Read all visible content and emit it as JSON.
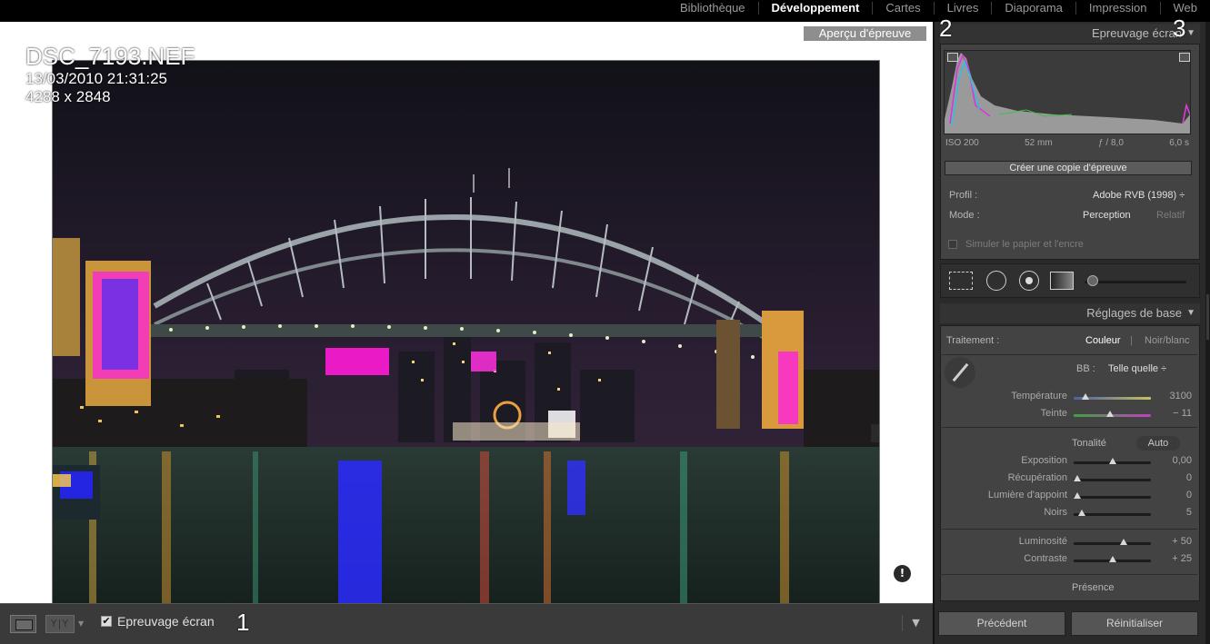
{
  "modules": [
    "Bibliothèque",
    "Développement",
    "Cartes",
    "Livres",
    "Diaporama",
    "Impression",
    "Web"
  ],
  "active_module_index": 1,
  "image_info": {
    "filename": "DSC_7193.NEF",
    "datetime": "13/03/2010 21:31:25",
    "dimensions": "4288 x 2848"
  },
  "preview_label": "Aperçu d'épreuve",
  "callouts": {
    "one": "1",
    "two": "2",
    "three": "3"
  },
  "warning_icon": "!",
  "toolbar": {
    "yy_label": "Y|Y",
    "proof_checked": "✔",
    "proof_label": "Epreuvage écran",
    "menu_icon": "▼"
  },
  "panel": {
    "proof_header": "Epreuvage écran",
    "histogram": {
      "iso": "ISO 200",
      "focal": "52 mm",
      "aperture": "ƒ / 8,0",
      "shutter": "6,0 s"
    },
    "copy_button": "Créer une copie d'épreuve",
    "profile_label": "Profil :",
    "profile_value": "Adobe RVB (1998) ÷",
    "mode_label": "Mode :",
    "mode_value": "Perception",
    "mode_alt": "Relatif",
    "simulate_label": "Simuler le papier et l'encre",
    "basic_header": "Réglages de base",
    "treatment_label": "Traitement :",
    "treatment_color": "Couleur",
    "treatment_bw": "Noir/blanc",
    "wb_label": "BB :",
    "wb_value": "Telle quelle ÷",
    "tone_label": "Tonalité",
    "auto_label": "Auto",
    "presence_label": "Présence",
    "sliders": [
      {
        "label": "Température",
        "value": "3100",
        "fraction": 0.15
      },
      {
        "label": "Teinte",
        "value": "− 11",
        "fraction": 0.47
      },
      {
        "label": "Exposition",
        "value": "0,00",
        "fraction": 0.5
      },
      {
        "label": "Récupération",
        "value": "0",
        "fraction": 0.05
      },
      {
        "label": "Lumière d'appoint",
        "value": "0",
        "fraction": 0.05
      },
      {
        "label": "Noirs",
        "value": "5",
        "fraction": 0.1
      },
      {
        "label": "Luminosité",
        "value": "+ 50",
        "fraction": 0.65
      },
      {
        "label": "Contraste",
        "value": "+ 25",
        "fraction": 0.5
      }
    ]
  },
  "footer": {
    "previous": "Précédent",
    "reset": "Réinitialiser"
  },
  "colors": {
    "panel_bg": "#434343",
    "accent_white": "#ffffff",
    "gamut_warning": "#ff00ff"
  }
}
